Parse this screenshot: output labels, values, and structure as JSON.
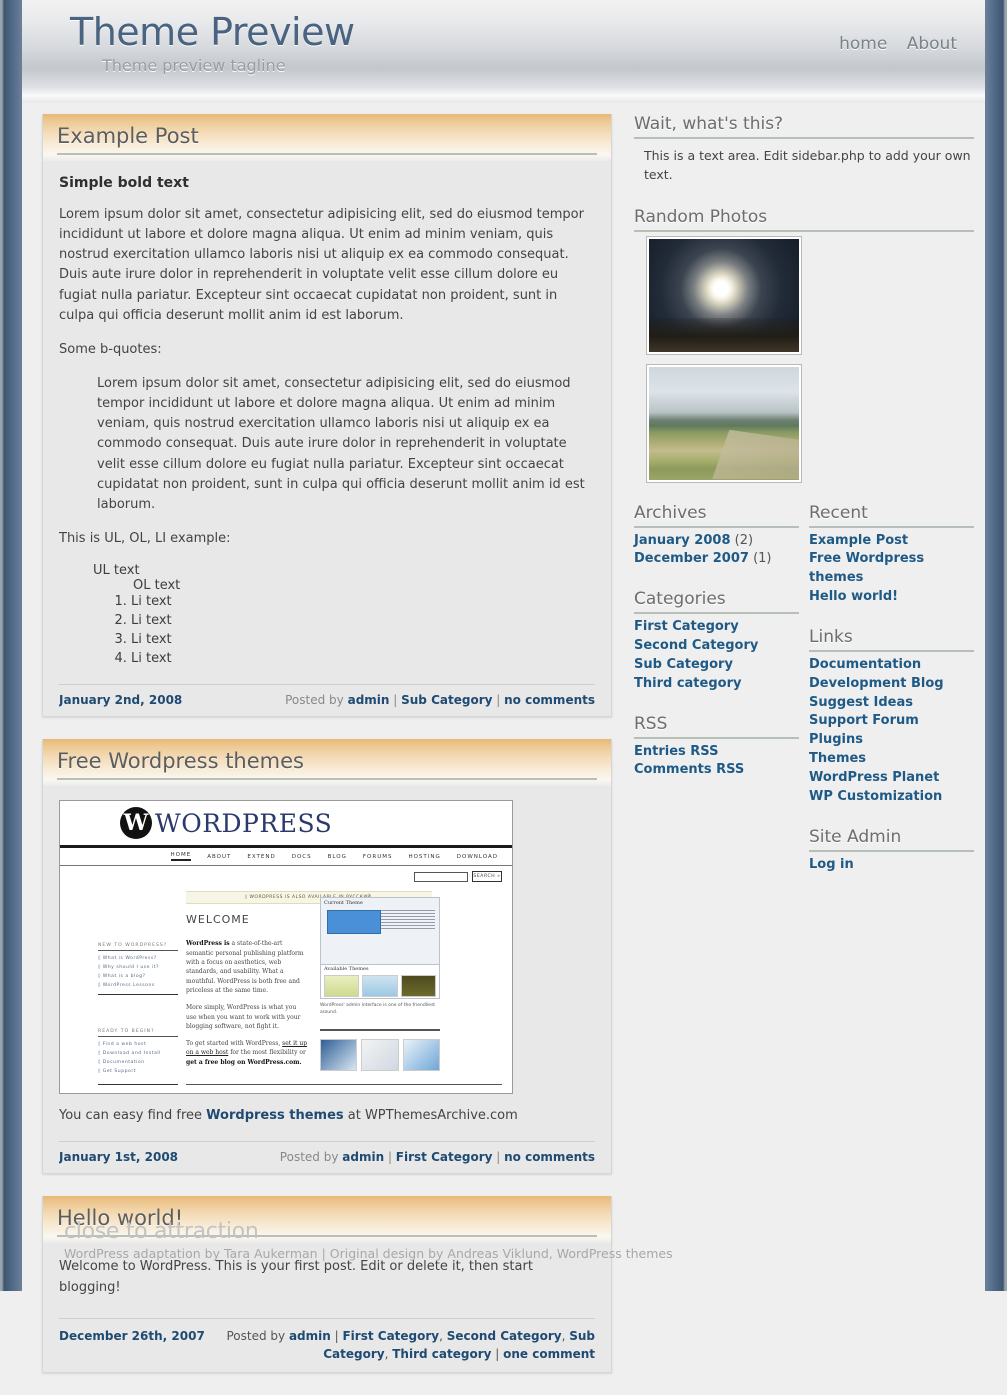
{
  "header": {
    "site_title": "Theme Preview",
    "tagline": "Theme preview tagline",
    "nav": [
      {
        "label": "home"
      },
      {
        "label": "About"
      }
    ]
  },
  "posts": [
    {
      "title": "Example Post",
      "bold_text": "Simple bold text",
      "paragraph1": "Lorem ipsum dolor sit amet, consectetur adipisicing elit, sed do eiusmod tempor incididunt ut labore et dolore magna aliqua. Ut enim ad minim veniam, quis nostrud exercitation ullamco laboris nisi ut aliquip ex ea commodo consequat. Duis aute irure dolor in reprehenderit in voluptate velit esse cillum dolore eu fugiat nulla pariatur. Excepteur sint occaecat cupidatat non proident, sunt in culpa qui officia deserunt mollit anim id est laborum.",
      "bquote_intro": "Some b-quotes:",
      "blockquote": "Lorem ipsum dolor sit amet, consectetur adipisicing elit, sed do eiusmod tempor incididunt ut labore et dolore magna aliqua. Ut enim ad minim veniam, quis nostrud exercitation ullamco laboris nisi ut aliquip ex ea commodo consequat. Duis aute irure dolor in reprehenderit in voluptate velit esse cillum dolore eu fugiat nulla pariatur. Excepteur sint occaecat cupidatat non proident, sunt in culpa qui officia deserunt mollit anim id est laborum.",
      "list_intro": "This is UL, OL, LI example:",
      "ul_text": "UL text",
      "ol_text": "OL text",
      "li_items": [
        "Li text",
        "Li text",
        "Li text",
        "Li text"
      ],
      "meta": {
        "date": "January 2nd, 2008",
        "posted_by_label": "Posted by",
        "author": "admin",
        "category": "Sub Category",
        "comments": "no comments"
      }
    },
    {
      "title": "Free Wordpress themes",
      "caption_pre": "You can easy find free ",
      "caption_link": "Wordpress themes",
      "caption_post": " at WPThemesArchive.com",
      "meta": {
        "date": "January 1st, 2008",
        "posted_by_label": "Posted by",
        "author": "admin",
        "category": "First Category",
        "comments": "no comments"
      }
    },
    {
      "title": "Hello world!",
      "paragraph1": "Welcome to WordPress. This is your first post. Edit or delete it, then start blogging!",
      "meta": {
        "date": "December 26th, 2007",
        "posted_by_label": "Posted by",
        "author": "admin",
        "categories": [
          "First Category",
          "Second Category",
          "Sub Category",
          "Third category"
        ],
        "comments": "one comment"
      }
    }
  ],
  "wp_screenshot": {
    "logo_letter": "W",
    "logo_text": "WORDPRESS",
    "nav": [
      "HOME",
      "ABOUT",
      "EXTEND",
      "DOCS",
      "BLOG",
      "FORUMS",
      "HOSTING",
      "DOWNLOAD"
    ],
    "search_button": "SEARCH »",
    "notice": "◊ WORDPRESS IS ALSO AVAILABLE IN РУССКИЙ.",
    "welcome": "WELCOME",
    "left_head_1": "NEW TO WORDPRESS?",
    "left_items_1": [
      "◊ What is WordPress?",
      "◊ Why should I use it?",
      "◊ What is a blog?",
      "◊ WordPress Lessons"
    ],
    "left_head_2": "READY TO BEGIN?",
    "left_items_2": [
      "◊ Find a web host",
      "◊ Download and Install",
      "◊ Documentation",
      "◊ Get Support"
    ],
    "body_p1_bold": "WordPress is",
    "body_p1": " a state-of-the-art semantic personal publishing platform with a focus on aesthetics, web standards, and usability. What a mouthful. WordPress is both free and priceless at the same time.",
    "body_p2": "More simply, WordPress is what you use when you want to work with your blogging software, not fight it.",
    "body_p3_pre": "To get started with WordPress, ",
    "body_p3_link1": "set it up on a web host",
    "body_p3_mid": " for the most flexibility or ",
    "body_p3_link2": "get a free blog on WordPress.com.",
    "panel_title": "Current Theme",
    "panel_sub": "WordPress Default  1.5  by Michael Heilemann",
    "avail_title": "Available Themes",
    "caption": "WordPress' admin interface is one of the friendliest around."
  },
  "sidebar": {
    "text_widget": {
      "title": "Wait, what's this?",
      "body": "This is a text area. Edit sidebar.php to add your own text."
    },
    "photos": {
      "title": "Random Photos",
      "items": [
        {
          "alt": "sun breaking through clouds over a dirt road"
        },
        {
          "alt": "cloudy mountain landscape with dirt track"
        }
      ]
    },
    "archives": {
      "title": "Archives",
      "items": [
        {
          "label": "January 2008",
          "count": "(2)"
        },
        {
          "label": "December 2007",
          "count": "(1)"
        }
      ]
    },
    "categories": {
      "title": "Categories",
      "items": [
        {
          "label": "First Category"
        },
        {
          "label": "Second Category"
        },
        {
          "label": "Sub Category"
        },
        {
          "label": "Third category"
        }
      ]
    },
    "rss": {
      "title": "RSS",
      "items": [
        {
          "label": "Entries RSS"
        },
        {
          "label": "Comments RSS"
        }
      ]
    },
    "recent": {
      "title": "Recent",
      "items": [
        {
          "label": "Example Post"
        },
        {
          "label": "Free Wordpress themes"
        },
        {
          "label": "Hello world!"
        }
      ]
    },
    "links": {
      "title": "Links",
      "items": [
        {
          "label": "Documentation"
        },
        {
          "label": "Development Blog"
        },
        {
          "label": "Suggest Ideas"
        },
        {
          "label": "Support Forum"
        },
        {
          "label": "Plugins"
        },
        {
          "label": "Themes"
        },
        {
          "label": "WordPress Planet"
        },
        {
          "label": "WP Customization"
        }
      ]
    },
    "site_admin": {
      "title": "Site Admin",
      "items": [
        {
          "label": "Log in"
        }
      ]
    }
  },
  "footer": {
    "title": "close to attraction",
    "credits": "WordPress adaptation by Tara Aukerman | Original design by Andreas Viklund, WordPress themes"
  },
  "colors": {
    "title_blue": "#4a6381",
    "link_blue": "#1f5a86",
    "meta_blue": "#1f4a72",
    "post_header_gold": "#e8b877",
    "page_bg": "#efefef",
    "edge_blue": "#4d6483"
  }
}
